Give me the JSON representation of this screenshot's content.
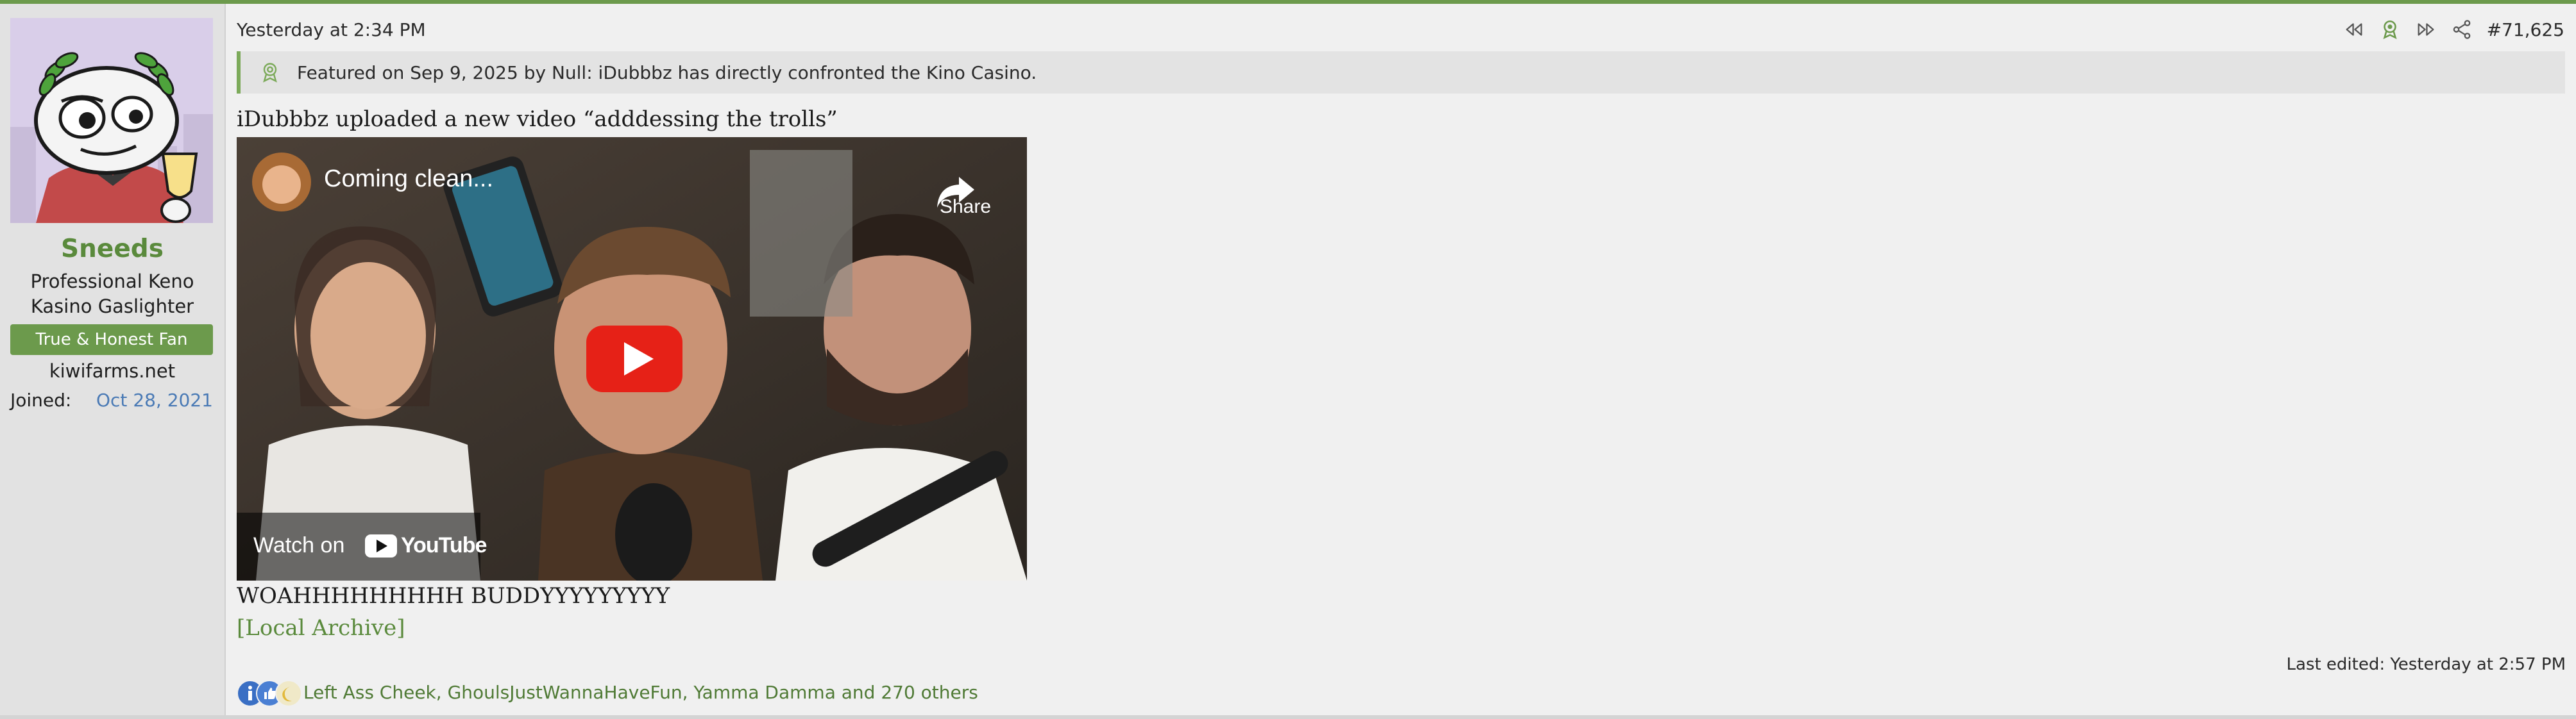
{
  "user": {
    "name": "Sneeds",
    "title_line1": "Professional Keno",
    "title_line2": "Kasino Gaslighter",
    "banner": "True & Honest Fan",
    "site": "kiwifarms.net",
    "joined_label": "Joined:",
    "joined_value": "Oct 28, 2021"
  },
  "post": {
    "date": "Yesterday at 2:34 PM",
    "number": "#71,625",
    "featured": "Featured on Sep 9, 2025 by Null: iDubbbz has directly confronted the Kino Casino.",
    "line1": "iDubbbz uploaded a new video “adddessing the trolls”",
    "line2": "WOAHHHHHHHHH BUDDYYYYYYYYY",
    "link": "[Local Archive]",
    "last_edited": "Last edited: Yesterday at 2:57 PM",
    "reactions_text": "Left Ass Cheek, GhoulsJustWannaHaveFun, Yamma Damma and 270 others"
  },
  "video": {
    "title": "Coming clean...",
    "share_label": "Share",
    "watch_on": "Watch on",
    "youtube_label": "YouTube"
  },
  "colors": {
    "accent": "#6c9a4c",
    "username": "#5a8a3c",
    "link": "#4a7ab5",
    "play": "#e62117"
  }
}
